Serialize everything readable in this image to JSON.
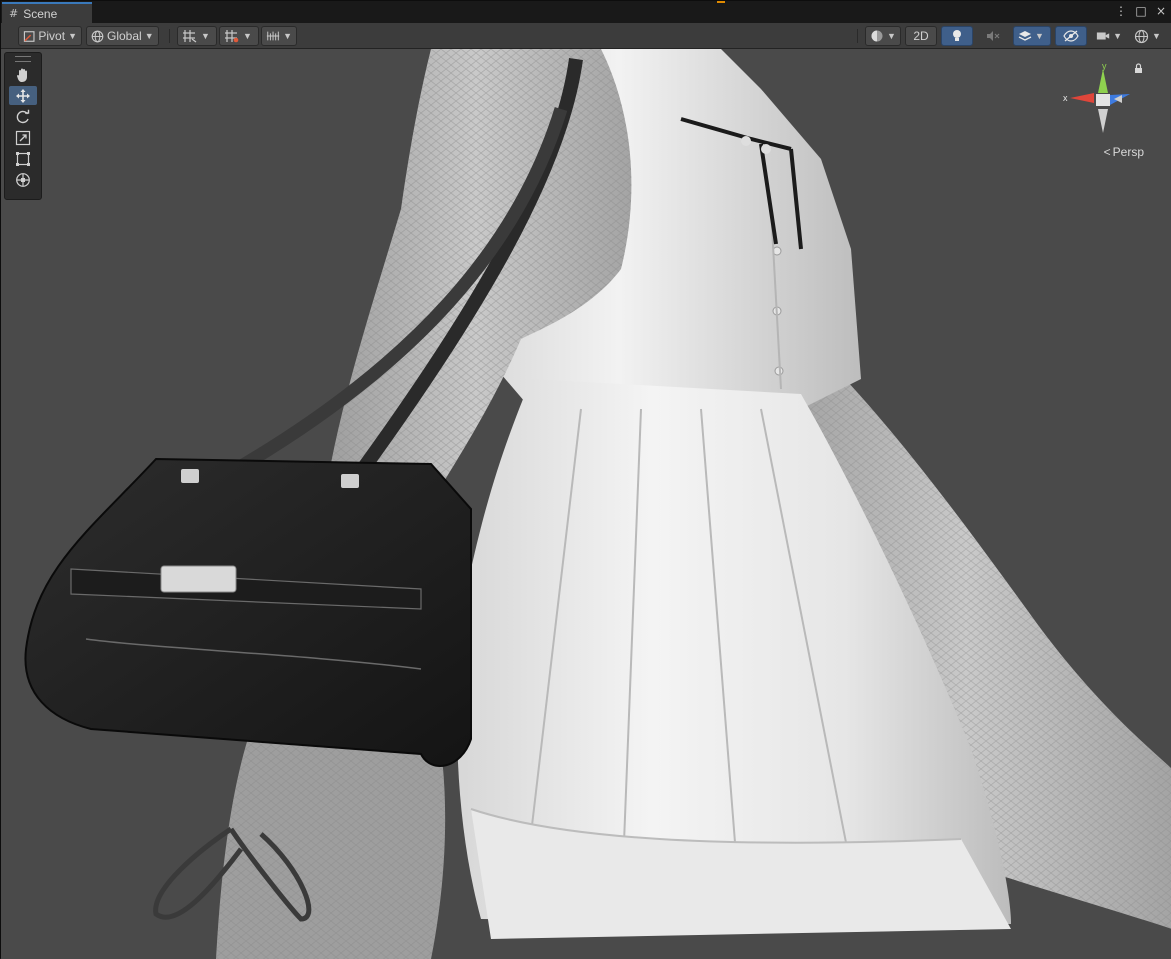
{
  "tab": {
    "title": "Scene"
  },
  "window_controls": {
    "more": "⋮",
    "maximize": "□",
    "close": "×"
  },
  "toolbar": {
    "pivot_label": "Pivot",
    "global_label": "Global",
    "two_d_label": "2D"
  },
  "tools": [
    {
      "name": "hand-tool",
      "icon": "hand-icon"
    },
    {
      "name": "move-tool",
      "icon": "move-icon",
      "selected": true
    },
    {
      "name": "rotate-tool",
      "icon": "rotate-icon"
    },
    {
      "name": "scale-tool",
      "icon": "scale-icon"
    },
    {
      "name": "rect-tool",
      "icon": "rect-icon"
    },
    {
      "name": "transform-tool",
      "icon": "transform-icon"
    }
  ],
  "gizmo": {
    "axis_x": "x",
    "axis_y": "y",
    "projection_label": "Persp",
    "colors": {
      "x": "#e0463a",
      "y": "#8fd14f",
      "z": "#3e7be0"
    }
  },
  "colors": {
    "viewport_bg": "#4a4a4a",
    "toolbar_bg": "#3c3c3c",
    "accent_active": "#3f5f8a",
    "tab_accent": "#3a79bb"
  }
}
